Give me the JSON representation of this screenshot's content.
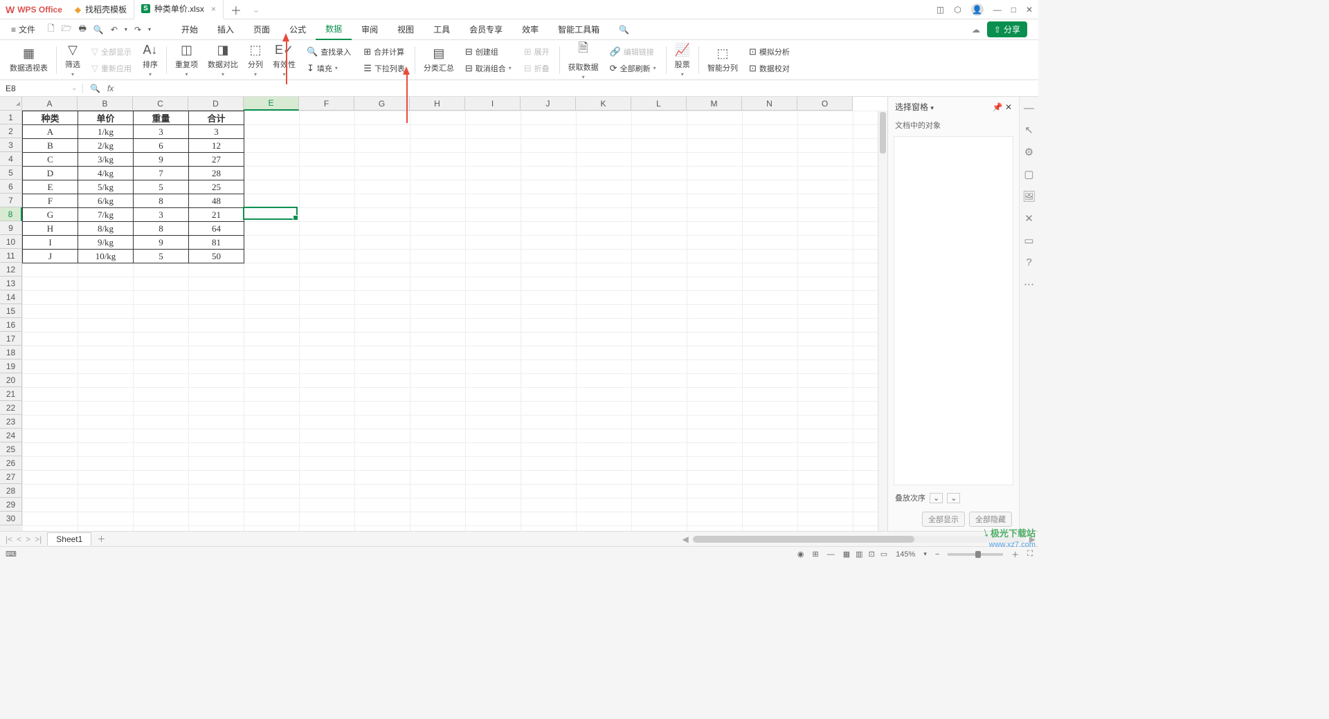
{
  "titlebar": {
    "app_name": "WPS Office",
    "tabs": [
      {
        "label": "找稻壳模板",
        "icon": "d"
      },
      {
        "label": "种类单价.xlsx",
        "icon": "s",
        "active": true
      }
    ]
  },
  "menubar": {
    "file_label": "文件",
    "items": [
      "开始",
      "插入",
      "页面",
      "公式",
      "数据",
      "审阅",
      "视图",
      "工具",
      "会员专享",
      "效率",
      "智能工具箱"
    ],
    "active_index": 4,
    "share_label": "分享"
  },
  "ribbon": {
    "pivot": "数据透视表",
    "filter": "筛选",
    "show_all": "全部显示",
    "reapply": "重新应用",
    "sort": "排序",
    "dup": "重复项",
    "compare": "数据对比",
    "split_col": "分列",
    "validity": "有效性",
    "find_entry": "查找录入",
    "fill": "填充",
    "consolidate": "合并计算",
    "dropdown_list": "下拉列表",
    "subtotal": "分类汇总",
    "group": "创建组",
    "ungroup": "取消组合",
    "expand": "展开",
    "collapse": "折叠",
    "get_data": "获取数据",
    "refresh_all": "全部刷新",
    "edit_link": "编辑链接",
    "stock": "股票",
    "smart_split": "智能分列",
    "whatif": "模拟分析",
    "data_check": "数据校对"
  },
  "formula_bar": {
    "name_box": "E8",
    "fx_label": "fx"
  },
  "columns": [
    "A",
    "B",
    "C",
    "D",
    "E",
    "F",
    "G",
    "H",
    "I",
    "J",
    "K",
    "L",
    "M",
    "N",
    "O"
  ],
  "active_col": "E",
  "row_count": 30,
  "active_row": 8,
  "selected_cell": "E8",
  "table": {
    "headers": [
      "种类",
      "单价",
      "重量",
      "合计"
    ],
    "rows": [
      [
        "A",
        "1/kg",
        "3",
        "3"
      ],
      [
        "B",
        "2/kg",
        "6",
        "12"
      ],
      [
        "C",
        "3/kg",
        "9",
        "27"
      ],
      [
        "D",
        "4/kg",
        "7",
        "28"
      ],
      [
        "E",
        "5/kg",
        "5",
        "25"
      ],
      [
        "F",
        "6/kg",
        "8",
        "48"
      ],
      [
        "G",
        "7/kg",
        "3",
        "21"
      ],
      [
        "H",
        "8/kg",
        "8",
        "64"
      ],
      [
        "I",
        "9/kg",
        "9",
        "81"
      ],
      [
        "J",
        "10/kg",
        "5",
        "50"
      ]
    ]
  },
  "side_panel": {
    "title": "选择窗格",
    "subtitle": "文档中的对象",
    "order_label": "叠放次序",
    "show_all": "全部显示",
    "hide_all": "全部隐藏"
  },
  "sheet_tabs": {
    "sheet1": "Sheet1"
  },
  "status_bar": {
    "zoom": "145%"
  },
  "watermark": {
    "line1": "极光下载站",
    "line2": "www.xz7.com"
  }
}
